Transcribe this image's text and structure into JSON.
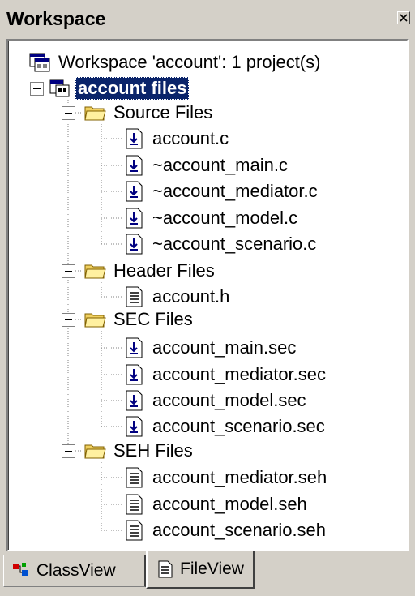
{
  "window": {
    "title": "Workspace"
  },
  "tree": {
    "workspace_label": "Workspace 'account': 1 project(s)",
    "project_label": "account files",
    "folders": [
      {
        "label": "Source Files",
        "files": [
          "account.c",
          "~account_main.c",
          "~account_mediator.c",
          "~account_model.c",
          "~account_scenario.c"
        ]
      },
      {
        "label": "Header Files",
        "files": [
          "account.h"
        ]
      },
      {
        "label": "SEC Files",
        "files": [
          "account_main.sec",
          "account_mediator.sec",
          "account_model.sec",
          "account_scenario.sec"
        ]
      },
      {
        "label": "SEH Files",
        "files": [
          "account_mediator.seh",
          "account_model.seh",
          "account_scenario.seh"
        ]
      }
    ]
  },
  "tabs": {
    "class_view": "ClassView",
    "file_view": "FileView",
    "active": "FileView"
  },
  "icons": {
    "workspace": "workspace-icon",
    "project": "project-icon",
    "folder": "folder-icon",
    "source_file": "source-file-icon",
    "text_file": "text-file-icon",
    "close": "close-icon",
    "class_view": "class-view-icon",
    "file_view": "file-view-icon"
  },
  "colors": {
    "selection": "#0a246a",
    "panel": "#d4d0c8",
    "folder": "#f0d060"
  }
}
